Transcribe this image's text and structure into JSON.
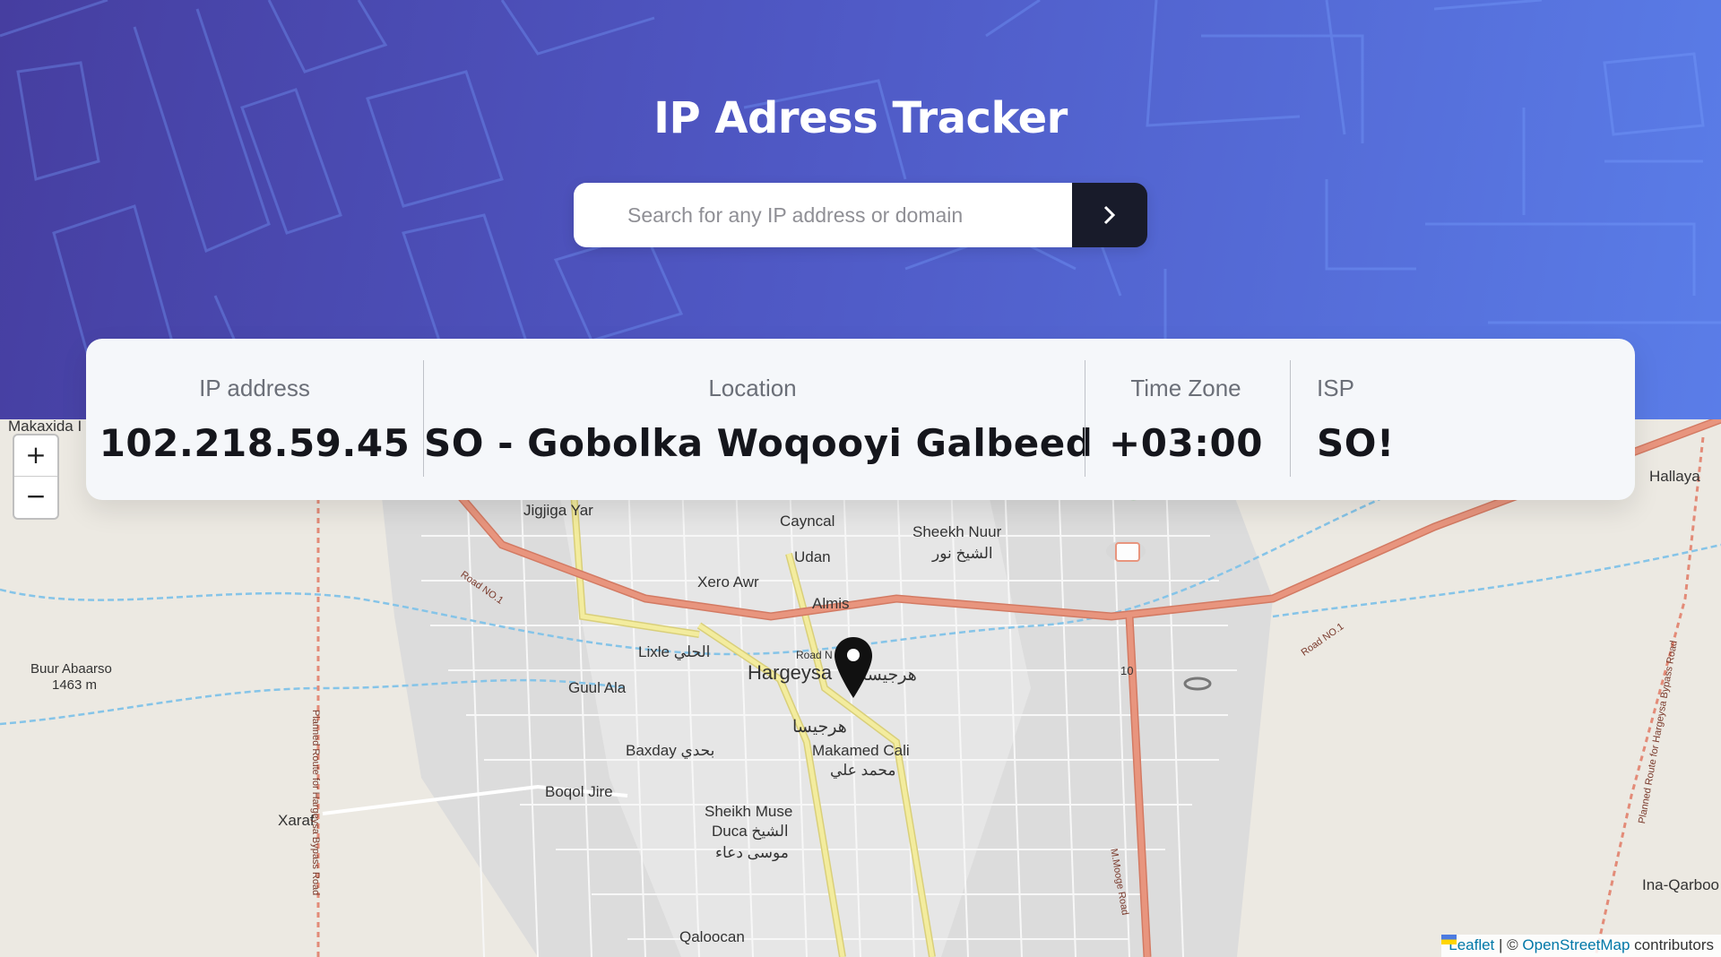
{
  "header": {
    "title": "IP Adress Tracker",
    "search_placeholder": "Search for any IP address or domain",
    "search_value": "",
    "submit_icon": "chevron-right-icon"
  },
  "info": {
    "ip": {
      "label": "IP address",
      "value": "102.218.59.45"
    },
    "location": {
      "label": "Location",
      "value": "SO - Gobolka Woqooyi Galbeed"
    },
    "timezone": {
      "label": "Time Zone",
      "value": "+03:00"
    },
    "isp": {
      "label": "ISP",
      "value": "SO!"
    }
  },
  "map": {
    "zoom_in": "+",
    "zoom_out": "−",
    "marker_icon": "map-pin-icon",
    "labels": {
      "makaxida": "Makaxida I",
      "hallaya": "Hallaya",
      "jigjiga": "Jigjiga Yar",
      "cayncal": "Cayncal",
      "udan": "Udan",
      "sheekh1": "Sheekh Nuur",
      "sheekh2": "الشيخ نور",
      "xero": "Xero Awr",
      "almis": "Almis",
      "lixle": "Lixle الحلي",
      "hargeysa": "Hargeysa",
      "hargeysa_ar": "هرجيسا",
      "road_top": "Road N",
      "guul": "Guul Ala",
      "buur1": "Buur Abaarso",
      "buur2": "1463 m",
      "baxday": "Baxday بحدي",
      "makamed1": "Makamed Cali",
      "makamed2": "محمد علي",
      "boqol": "Boqol Jire",
      "xaraf": "Xaraf",
      "sheikh1": "Sheikh Muse",
      "sheikh2": "Duca الشيخ",
      "sheikh3": "موسى دعاء",
      "qaloocan": "Qaloocan",
      "inaqarboo": "Ina-Qarboo",
      "road10": "10",
      "roadno1a": "Road NO.1",
      "roadno1b": "Road NO.1",
      "moogerd": "M.Mooge Road",
      "planned1": "Planned Route for Hargeysa Bypass Road",
      "planned2": "Planned Route for Hargeysa Bypass Road"
    },
    "attribution": {
      "leaflet": "Leaflet",
      "sep": "| ©",
      "osm": "OpenStreetMap",
      "contrib": "contributors"
    }
  },
  "colors": {
    "hero_start": "#463ea0",
    "hero_end": "#5a7de8",
    "button": "#181b2a",
    "card_bg": "#f5f7fa",
    "road_major": "#e8957e",
    "road_secondary": "#f3ec9e",
    "water": "#85c4e8"
  }
}
